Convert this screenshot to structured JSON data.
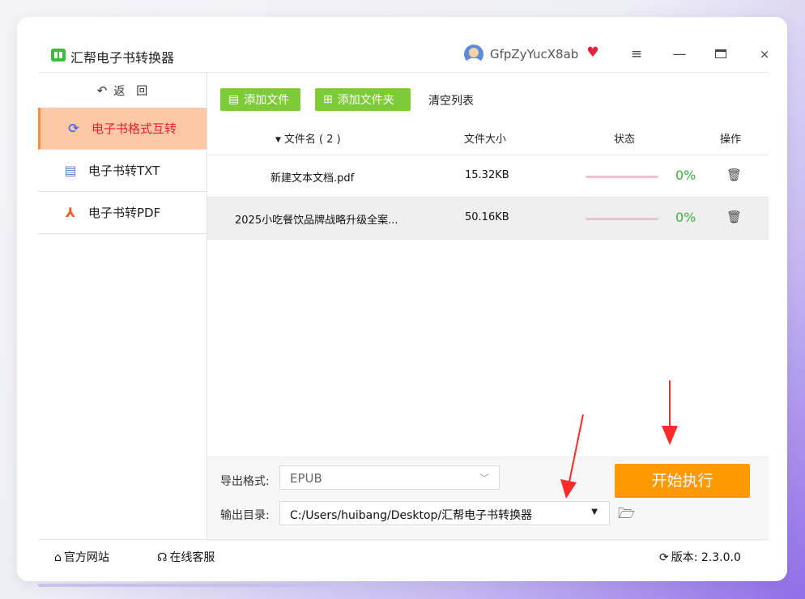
{
  "app": {
    "title": "汇帮电子书转换器",
    "username": "GfpZyYucX8ab",
    "accent": "#ff9900",
    "active_color": "#e5222d",
    "green": "#7ecb3a"
  },
  "titlebar_icons": {
    "menu": "≡",
    "minimize": "—",
    "close": "×"
  },
  "sidebar": {
    "back_label": "返　回",
    "items": [
      {
        "label": "电子书格式互转",
        "icon": "refresh-icon",
        "active": true
      },
      {
        "label": "电子书转TXT",
        "icon": "txt-file-icon",
        "active": false
      },
      {
        "label": "电子书转PDF",
        "icon": "pdf-icon",
        "active": false
      }
    ]
  },
  "toolbar": {
    "add_file": "添加文件",
    "add_folder": "添加文件夹",
    "clear": "清空列表"
  },
  "table": {
    "headers": {
      "name": "文件名 ( 2 )",
      "size": "文件大小",
      "status": "状态",
      "op": "操作"
    },
    "rows": [
      {
        "name": "新建文本文档.pdf",
        "size": "15.32KB",
        "progress_pct": "0%",
        "progress": 0
      },
      {
        "name": "2025小吃餐饮品牌战略升级全案...",
        "size": "50.16KB",
        "progress_pct": "0%",
        "progress": 0
      }
    ]
  },
  "settings": {
    "format_label": "导出格式:",
    "format_value": "EPUB",
    "dir_label": "输出目录:",
    "dir_value": "C:/Users/huibang/Desktop/汇帮电子书转换器",
    "start_label": "开始执行"
  },
  "statusbar": {
    "home": "官方网站",
    "service": "在线客服",
    "version": "版本: 2.3.0.0"
  }
}
